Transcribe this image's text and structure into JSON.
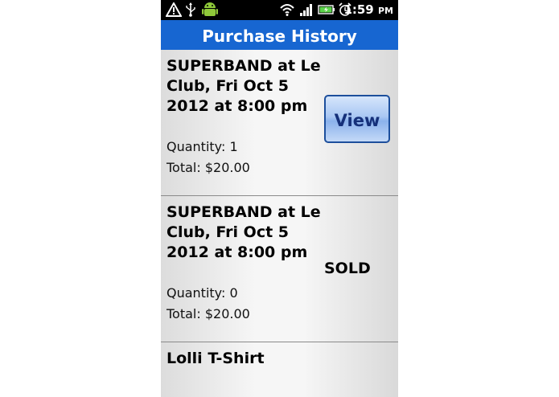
{
  "status_bar": {
    "time": "1:59",
    "ampm": "PM",
    "icons": [
      "warning-icon",
      "usb-icon",
      "android-icon",
      "wifi-icon",
      "signal-icon",
      "battery-icon",
      "alarm-icon"
    ]
  },
  "header": {
    "title": "Purchase History"
  },
  "purchases": [
    {
      "name": "SUPERBAND at Le Club, Fri Oct 5 2012 at 8:00 pm",
      "quantity": "Quantity: 1",
      "total": "Total: $20.00",
      "action": "View"
    },
    {
      "name": "SUPERBAND at Le Club, Fri Oct 5 2012 at 8:00 pm",
      "quantity": "Quantity: 0",
      "total": "Total: $20.00",
      "status": "SOLD"
    },
    {
      "name": "Lolli T-Shirt"
    }
  ],
  "colors": {
    "title_bar": "#1766d1",
    "status_bar": "#000000",
    "button_border": "#1d4f9c"
  }
}
